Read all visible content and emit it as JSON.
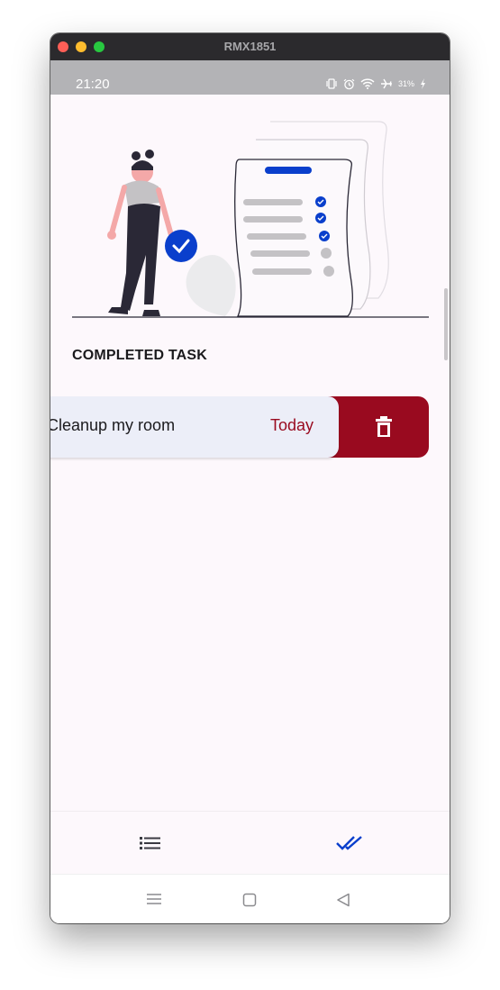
{
  "window": {
    "title": "RMX1851"
  },
  "status_bar": {
    "time": "21:20",
    "battery": "31%"
  },
  "content": {
    "section_title": "COMPLETED TASK",
    "tasks": [
      {
        "name": "Cleanup my room",
        "date": "Today"
      }
    ]
  },
  "icons": {
    "illustration": "completed-tasks-illustration",
    "delete": "trash-icon",
    "nav_tasks": "list-icon",
    "nav_completed": "double-check-icon"
  },
  "colors": {
    "accent": "#0a3fcc",
    "danger": "#990a1f",
    "card": "#eceef8",
    "background": "#fdf8fc"
  }
}
